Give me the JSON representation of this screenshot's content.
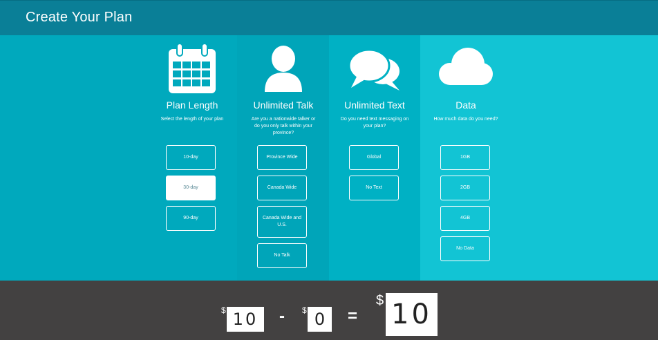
{
  "header": {
    "title": "Create Your Plan"
  },
  "columns": {
    "plan_length": {
      "icon": "calendar-icon",
      "title": "Plan Length",
      "description": "Select the length of your plan",
      "options": [
        "10-day",
        "30-day",
        "90-day"
      ],
      "selected": "30-day"
    },
    "unlimited_talk": {
      "icon": "person-icon",
      "title": "Unlimited Talk",
      "description": "Are you a nationwide talker or do you only talk within your province?",
      "options": [
        "Province Wide",
        "Canada Wide",
        "Canada Wide and U.S.",
        "No Talk"
      ]
    },
    "unlimited_text": {
      "icon": "chat-bubbles-icon",
      "title": "Unlimited Text",
      "description": "Do you need text messaging on your plan?",
      "options": [
        "Global",
        "No Text"
      ]
    },
    "data": {
      "icon": "cloud-icon",
      "title": "Data",
      "description": "How much data do you need?",
      "options": [
        "1GB",
        "2GB",
        "4GB",
        "No Data"
      ]
    }
  },
  "footer": {
    "currency": "$",
    "price": "10",
    "minus": "-",
    "discount": "0",
    "equals": "=",
    "total": "10"
  },
  "colors": {
    "header": "#0a7f97",
    "main": "#00a9bd",
    "footer": "#434141"
  }
}
